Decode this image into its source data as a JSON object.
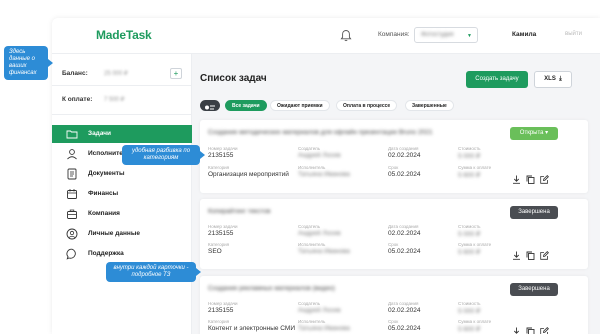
{
  "app": {
    "logo": "MadeTask",
    "company_label": "Компания:",
    "company_value": "Фотостудия",
    "user_name": "Камила",
    "logout": "выйти"
  },
  "sidebar": {
    "balance_label": "Баланс:",
    "balance_value": "25 000 ₽",
    "topay_label": "К оплате:",
    "topay_value": "7 500 ₽",
    "add_label": "+",
    "items": [
      {
        "label": "Задачи",
        "icon": "folder-icon",
        "active": true
      },
      {
        "label": "Исполнители",
        "icon": "user-icon",
        "active": false
      },
      {
        "label": "Документы",
        "icon": "document-icon",
        "active": false
      },
      {
        "label": "Финансы",
        "icon": "finance-icon",
        "active": false
      },
      {
        "label": "Компания",
        "icon": "briefcase-icon",
        "active": false
      },
      {
        "label": "Личные данные",
        "icon": "person-circle-icon",
        "active": false
      },
      {
        "label": "Поддержка",
        "icon": "chat-icon",
        "active": false
      }
    ]
  },
  "main": {
    "title": "Список задач",
    "create_button": "Создать задачу",
    "xls_button": "XLS",
    "filters": [
      "Все задачи",
      "Ожидают приемки",
      "Оплата в процессе",
      "Завершенные"
    ]
  },
  "field_labels": {
    "number": "Номер задачи",
    "creator": "Создатель",
    "created": "Дата создания",
    "cost": "Стоимость",
    "category": "Категория",
    "executor": "Исполнитель",
    "deadline": "Срок",
    "total": "Сумма к оплате"
  },
  "cards": [
    {
      "title": "Создание методических материалов для офлайн презентации Bruno 2021",
      "status": "Открыта ▾",
      "number": "2135155",
      "creator": "Андрей Лосев",
      "created": "02.02.2024",
      "cost": "5 000 ₽",
      "category": "Организация мероприятий",
      "executor": "Татьяна Иванова",
      "deadline": "05.02.2024",
      "total": "5 600 ₽"
    },
    {
      "title": "Копирайтинг текстов",
      "status": "Завершена",
      "number": "2135155",
      "creator": "Андрей Лосев",
      "created": "02.02.2024",
      "cost": "5 000 ₽",
      "category": "SEO",
      "executor": "Татьяна Иванова",
      "deadline": "05.02.2024",
      "total": "5 600 ₽"
    },
    {
      "title": "Создание рекламных материалов (видео)",
      "status": "Завершена",
      "number": "2135155",
      "creator": "Андрей Лосев",
      "created": "02.02.2024",
      "cost": "5 000 ₽",
      "category": "Контент и электронные СМИ",
      "executor": "Татьяна Иванова",
      "deadline": "05.02.2024",
      "total": "5 600 ₽"
    }
  ],
  "callouts": {
    "finance": "Здесь данные о ваших финансах",
    "categories": "удобная разбивка по категориям",
    "details": "внутри каждой карточки - подробное ТЗ"
  },
  "colors": {
    "accent": "#1e9b5e",
    "open_status": "#6abf5a",
    "done_status": "#4a4d52",
    "callout": "#2d8cd6"
  }
}
